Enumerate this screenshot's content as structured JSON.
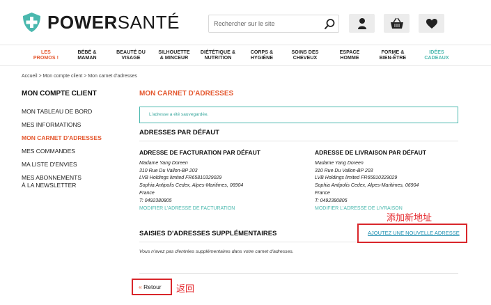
{
  "header": {
    "logo": {
      "brand_bold": "POWER",
      "brand_light": "SANTÉ",
      "accent": "#4ab8ae"
    },
    "search": {
      "placeholder": "Rechercher sur le site",
      "value": ""
    },
    "icons": [
      "search-icon",
      "user-icon",
      "basket-icon",
      "heart-icon"
    ]
  },
  "nav": {
    "items": [
      {
        "label": "LES\nPROMOS !",
        "style": "promo"
      },
      {
        "label": "BÉBÉ &\nMAMAN",
        "style": ""
      },
      {
        "label": "BEAUTÉ DU\nVISAGE",
        "style": ""
      },
      {
        "label": "SILHOUETTE\n& MINCEUR",
        "style": ""
      },
      {
        "label": "DIÉTÉTIQUE &\nNUTRITION",
        "style": ""
      },
      {
        "label": "CORPS &\nHYGIÈNE",
        "style": ""
      },
      {
        "label": "SOINS DES\nCHEVEUX",
        "style": ""
      },
      {
        "label": "ESPACE\nHOMME",
        "style": ""
      },
      {
        "label": "FORME &\nBIEN-ÊTRE",
        "style": ""
      },
      {
        "label": "IDÉES\nCADEAUX",
        "style": "gift"
      }
    ]
  },
  "breadcrumb": "Accueil > Mon compte client > Mon carnet d'adresses",
  "sidebar": {
    "title": "MON COMPTE CLIENT",
    "items": [
      {
        "label": "MON TABLEAU DE BORD",
        "active": false
      },
      {
        "label": "MES INFORMATIONS",
        "active": false
      },
      {
        "label": "MON CARNET D'ADRESSES",
        "active": true
      },
      {
        "label": "MES COMMANDES",
        "active": false
      },
      {
        "label": "MA LISTE D'ENVIES",
        "active": false
      },
      {
        "label": "MES ABONNEMENTS\nÀ LA NEWSLETTER",
        "active": false
      }
    ]
  },
  "main": {
    "title": "MON CARNET D'ADRESSES",
    "success_message": "L'adresse a été sauvegardée.",
    "default_section_title": "ADRESSES PAR DÉFAUT",
    "billing": {
      "title": "ADRESSE DE FACTURATION PAR DÉFAUT",
      "lines": [
        "Madame Yang Doreen",
        "310 Rue Du Vallon-BP 203",
        "LVB Holdings limited FR65810329029",
        "Sophia Antipolis Cedex, Alpes-Maritimes, 06904",
        "France",
        "T: 0492380805"
      ],
      "edit_link": "MODIFIER L'ADRESSE DE FACTURATION"
    },
    "shipping": {
      "title": "ADRESSE DE LIVRAISON PAR DÉFAUT",
      "lines": [
        "Madame Yang Doreen",
        "310 Rue Du Vallon-BP 203",
        "LVB Holdings limited FR65810329029",
        "Sophia Antipolis Cedex, Alpes-Maritimes, 06904",
        "France",
        "T: 0492380805"
      ],
      "edit_link": "MODIFIER L'ADRESSE DE LIVRAISON"
    },
    "extra_section_title": "SAISIES D'ADRESSES SUPPLÉMENTAIRES",
    "add_address_link": "AJOUTEZ UNE NOUVELLE ADRESSE",
    "empty_note": "Vous n'avez pas d'entrées supplémentaires dans votre carnet d'adresses.",
    "back_arrow": "«",
    "back_label": "Retour"
  },
  "annotations": {
    "add_address": "添加新地址",
    "back": "返回",
    "color": "#e4262b"
  }
}
